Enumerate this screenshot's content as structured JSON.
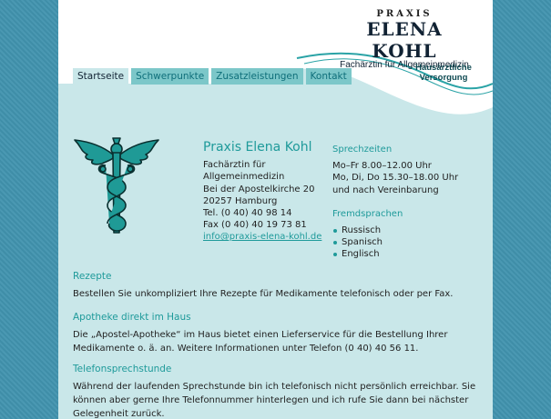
{
  "logo": {
    "praxis": "PRAXIS",
    "name": "ELENA KOHL",
    "subtitle": "Fachärztin für Allgemeinmedizin"
  },
  "badge": {
    "line1": "Hausärztliche",
    "line2": "Versorgung"
  },
  "nav": {
    "tabs": [
      {
        "label": "Startseite"
      },
      {
        "label": "Schwerpunkte"
      },
      {
        "label": "Zusatzleistungen"
      },
      {
        "label": "Kontakt"
      }
    ]
  },
  "contact": {
    "title": "Praxis Elena Kohl",
    "lines": [
      "Fachärztin für",
      "Allgemeinmedizin",
      "Bei der Apostelkirche 20",
      "20257 Hamburg",
      "Tel. (0 40) 40 98 14",
      "Fax (0 40) 40 19 73 81"
    ],
    "email": "info@praxis-elena-kohl.de"
  },
  "hours": {
    "title": "Sprechzeiten",
    "lines": [
      "Mo–Fr 8.00–12.00 Uhr",
      "Mo, Di, Do 15.30–18.00 Uhr",
      "und nach Vereinbarung"
    ]
  },
  "languages": {
    "title": "Fremdsprachen",
    "items": [
      "Russisch",
      "Spanisch",
      "Englisch"
    ]
  },
  "sections": [
    {
      "title": "Rezepte",
      "text": "Bestellen Sie unkompliziert Ihre Rezepte für Medikamente telefonisch oder per Fax."
    },
    {
      "title": "Apotheke direkt im Haus",
      "text": "Die „Apostel-Apotheke“ im Haus bietet einen Lieferservice für die Bestellung Ihrer Medikamente o. ä. an. Weitere Informationen unter Telefon (0 40) 40 56 11."
    },
    {
      "title": "Telefonsprechstunde",
      "text": "Während der laufenden Sprechstunde bin ich telefonisch nicht persönlich erreichbar. Sie können aber gerne Ihre Telefonnummer hinterlegen und ich rufe Sie dann bei nächster Gelegenheit zurück."
    }
  ],
  "colors": {
    "accent": "#1e9a9a",
    "panel": "#c9e7e9",
    "background": "#3f8ea8",
    "tab": "#7cc7c9"
  },
  "icons": {
    "emblem": "caduceus-icon"
  }
}
